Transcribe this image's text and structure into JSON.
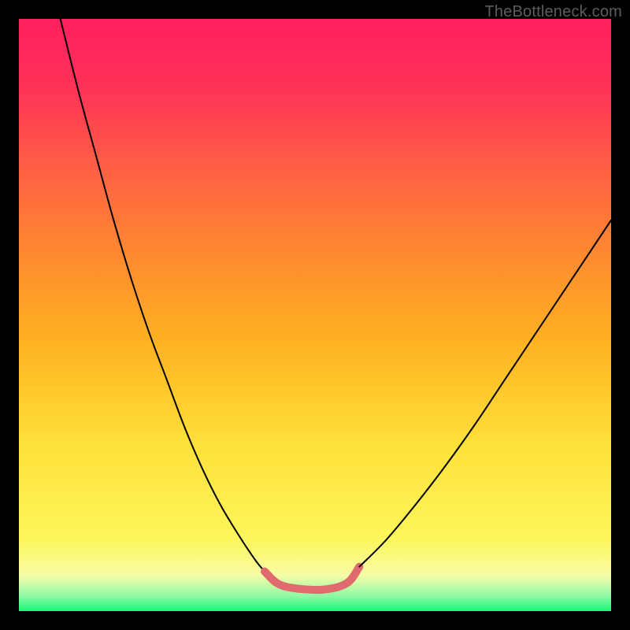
{
  "watermark": "TheBottleneck.com",
  "chart_data": {
    "type": "line",
    "title": "",
    "xlabel": "",
    "ylabel": "",
    "xlim": [
      0,
      1
    ],
    "ylim": [
      0,
      1
    ],
    "grid": false,
    "legend": false,
    "series": [
      {
        "name": "left-curve",
        "color": "#000000",
        "width": 2,
        "x": [
          0.07,
          0.1,
          0.13,
          0.16,
          0.19,
          0.22,
          0.25,
          0.28,
          0.31,
          0.34,
          0.37,
          0.4,
          0.415
        ],
        "y": [
          1.0,
          0.88,
          0.77,
          0.66,
          0.56,
          0.47,
          0.39,
          0.31,
          0.24,
          0.18,
          0.13,
          0.085,
          0.067
        ]
      },
      {
        "name": "trough-highlight",
        "color": "#e06a6d",
        "width": 10,
        "x": [
          0.415,
          0.44,
          0.48,
          0.52,
          0.555,
          0.575
        ],
        "y": [
          0.067,
          0.045,
          0.037,
          0.037,
          0.048,
          0.075
        ]
      },
      {
        "name": "right-curve",
        "color": "#000000",
        "width": 2,
        "x": [
          0.575,
          0.62,
          0.67,
          0.72,
          0.77,
          0.82,
          0.87,
          0.92,
          0.97,
          1.0
        ],
        "y": [
          0.075,
          0.12,
          0.18,
          0.245,
          0.315,
          0.39,
          0.465,
          0.54,
          0.615,
          0.66
        ]
      }
    ],
    "gradient_stops": [
      {
        "pos": 0.0,
        "color": "#17f77a"
      },
      {
        "pos": 0.025,
        "color": "#8cf9a6"
      },
      {
        "pos": 0.06,
        "color": "#f7fca8"
      },
      {
        "pos": 0.12,
        "color": "#fdf65c"
      },
      {
        "pos": 0.28,
        "color": "#ffe13a"
      },
      {
        "pos": 0.45,
        "color": "#ffb321"
      },
      {
        "pos": 0.6,
        "color": "#ff8a2f"
      },
      {
        "pos": 0.75,
        "color": "#ff5f45"
      },
      {
        "pos": 0.88,
        "color": "#ff3357"
      },
      {
        "pos": 1.0,
        "color": "#ff1f5f"
      }
    ]
  }
}
